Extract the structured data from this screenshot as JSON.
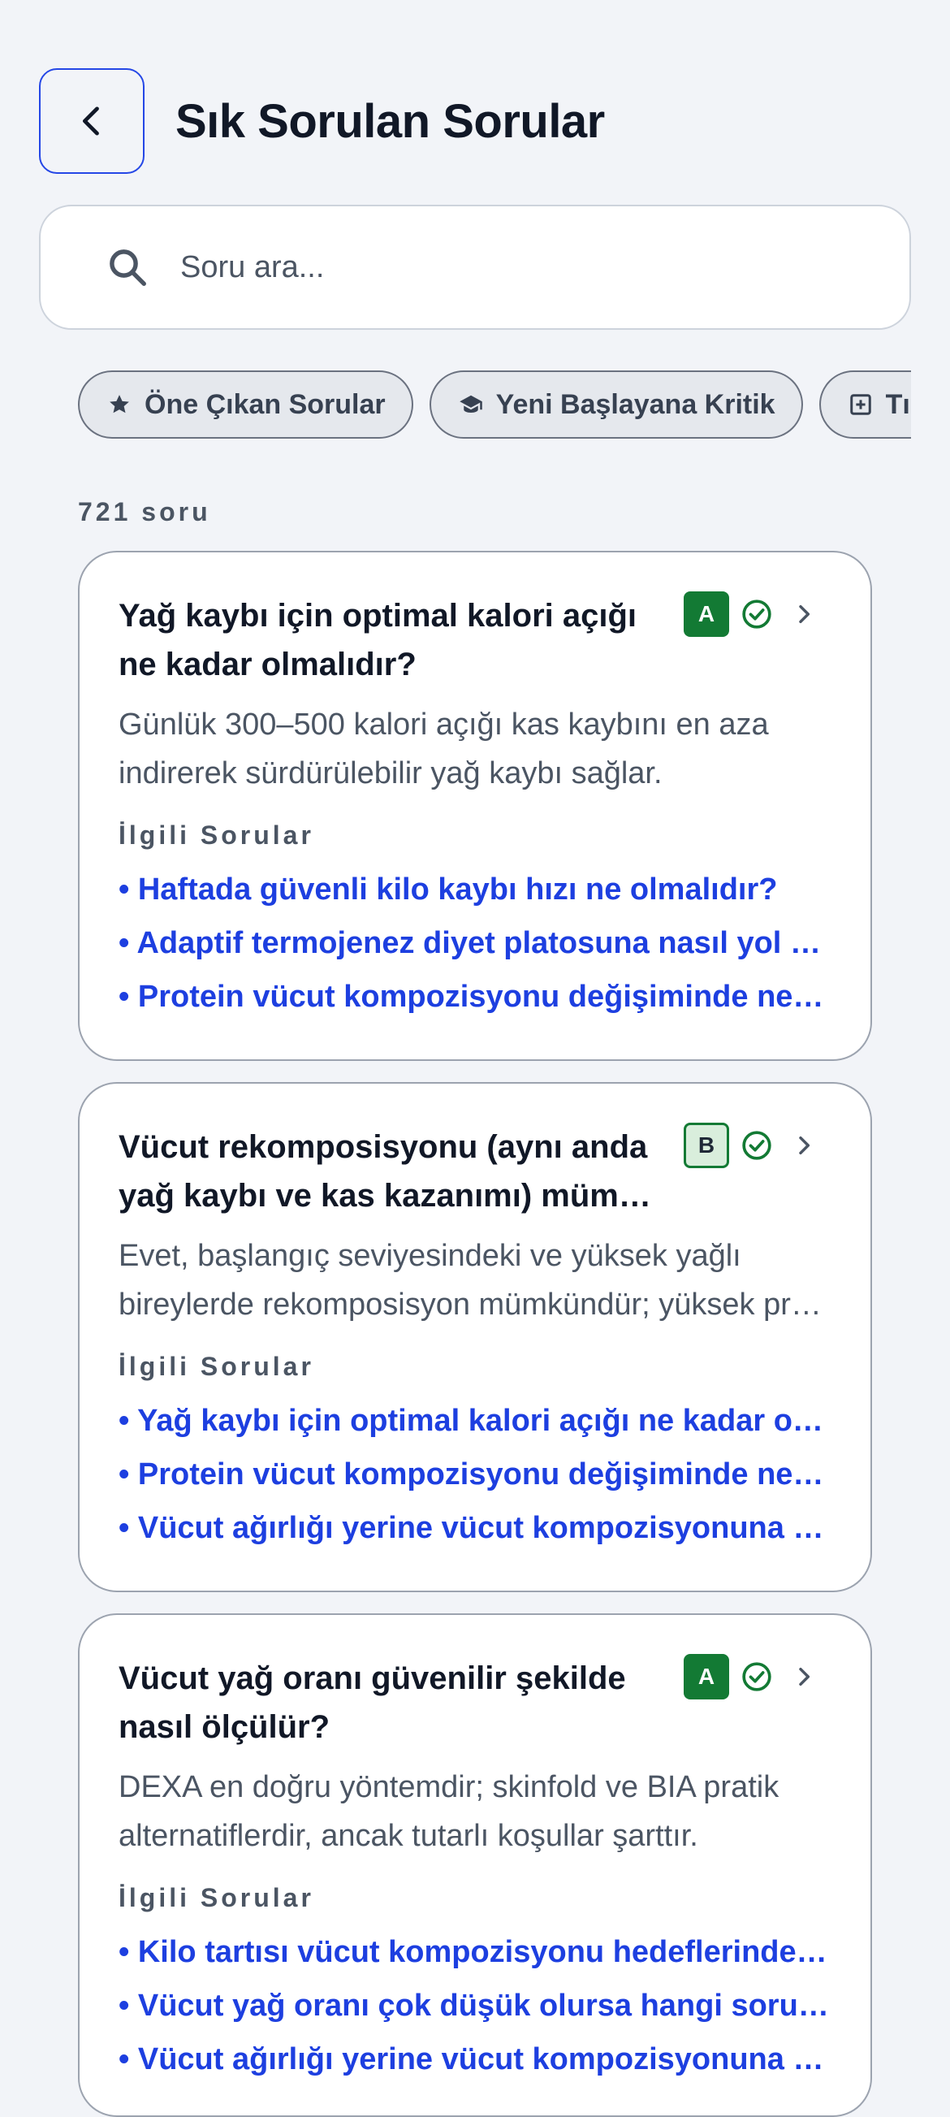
{
  "header": {
    "title": "Sık Sorulan Sorular"
  },
  "search": {
    "placeholder": "Soru ara..."
  },
  "chips": [
    {
      "label": "Öne Çıkan Sorular",
      "icon": "star-icon"
    },
    {
      "label": "Yeni Başlayana Kritik",
      "icon": "graduation-cap-icon"
    },
    {
      "label": "Tıbbi",
      "icon": "medical-plus-icon"
    }
  ],
  "count_label": "721 soru",
  "related_heading": "İlgili Sorular",
  "colors": {
    "accent": "#1d3fe0",
    "grade_green": "#137a34"
  },
  "faqs": [
    {
      "title_lines": [
        "Yağ kaybı için optimal kalori açığı",
        "ne kadar olmalıdır?"
      ],
      "grade": "A",
      "answer_lines": [
        "Günlük 300–500 kalori açığı kas kaybını en aza",
        "indirerek sürdürülebilir yağ kaybı sağlar."
      ],
      "related": [
        "• Haftada güvenli kilo kaybı hızı ne olmalıdır?",
        "• Adaptif termojenez diyet platosuna nasıl yol açar?",
        "• Protein vücut kompozisyonu değişiminde neden önemlidir?"
      ]
    },
    {
      "title_lines": [
        "Vücut rekomposisyonu (aynı anda",
        "yağ kaybı ve kas kazanımı) mümkün mü?"
      ],
      "grade": "B",
      "answer_lines": [
        "Evet, başlangıç seviyesindeki ve yüksek yağlı",
        "bireylerde rekomposisyon mümkündür; yüksek protein gerekir."
      ],
      "related": [
        "• Yağ kaybı için optimal kalori açığı ne kadar olmalıdır?",
        "• Protein vücut kompozisyonu değişiminde neden önemlidir?",
        "• Vücut ağırlığı yerine vücut kompozisyonuna göre takip"
      ]
    },
    {
      "title_lines": [
        "Vücut yağ oranı güvenilir şekilde",
        "nasıl ölçülür?"
      ],
      "grade": "A",
      "answer_lines": [
        "DEXA en doğru yöntemdir; skinfold ve BIA pratik",
        "alternatiflerdir, ancak tutarlı koşullar şarttır."
      ],
      "related": [
        "• Kilo tartısı vücut kompozisyonu hedeflerinde yanıltıcı mı?",
        "• Vücut yağ oranı çok düşük olursa hangi sorunlar olur?",
        "• Vücut ağırlığı yerine vücut kompozisyonuna göre takip"
      ]
    }
  ]
}
